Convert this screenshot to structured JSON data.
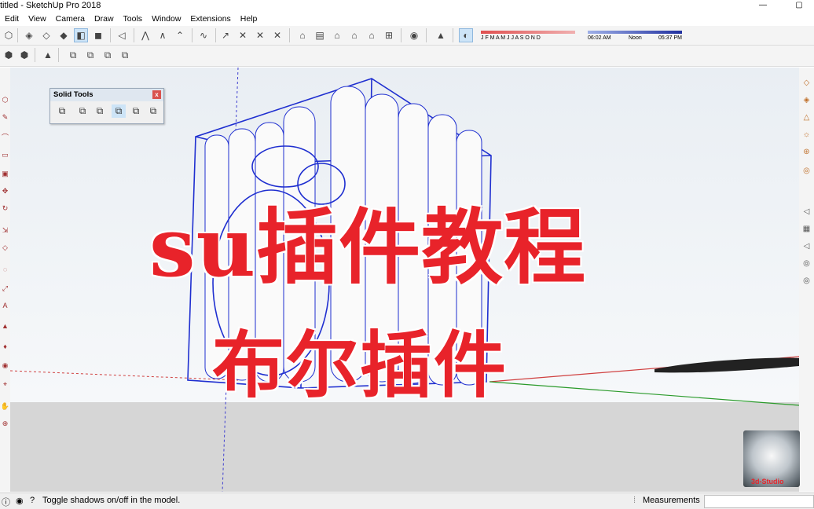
{
  "window": {
    "title": "titled - SketchUp Pro 2018"
  },
  "menu": [
    "Edit",
    "View",
    "Camera",
    "Draw",
    "Tools",
    "Window",
    "Extensions",
    "Help"
  ],
  "shadow_settings": {
    "months": "J F M A M J J A S O N D",
    "time_start": "06:02 AM",
    "time_mid": "Noon",
    "time_end": "05:37 PM"
  },
  "solid_tools": {
    "title": "Solid Tools",
    "close": "x"
  },
  "overlay": {
    "line1": "su插件教程",
    "line2": "布尔插件"
  },
  "status": {
    "message": "Toggle shadows on/off in the model.",
    "measurements_label": "Measurements"
  },
  "watermark": {
    "text": "3d-Studio"
  },
  "colors": {
    "accent_red": "#e8232a",
    "model_blue": "#1f2fd0"
  }
}
